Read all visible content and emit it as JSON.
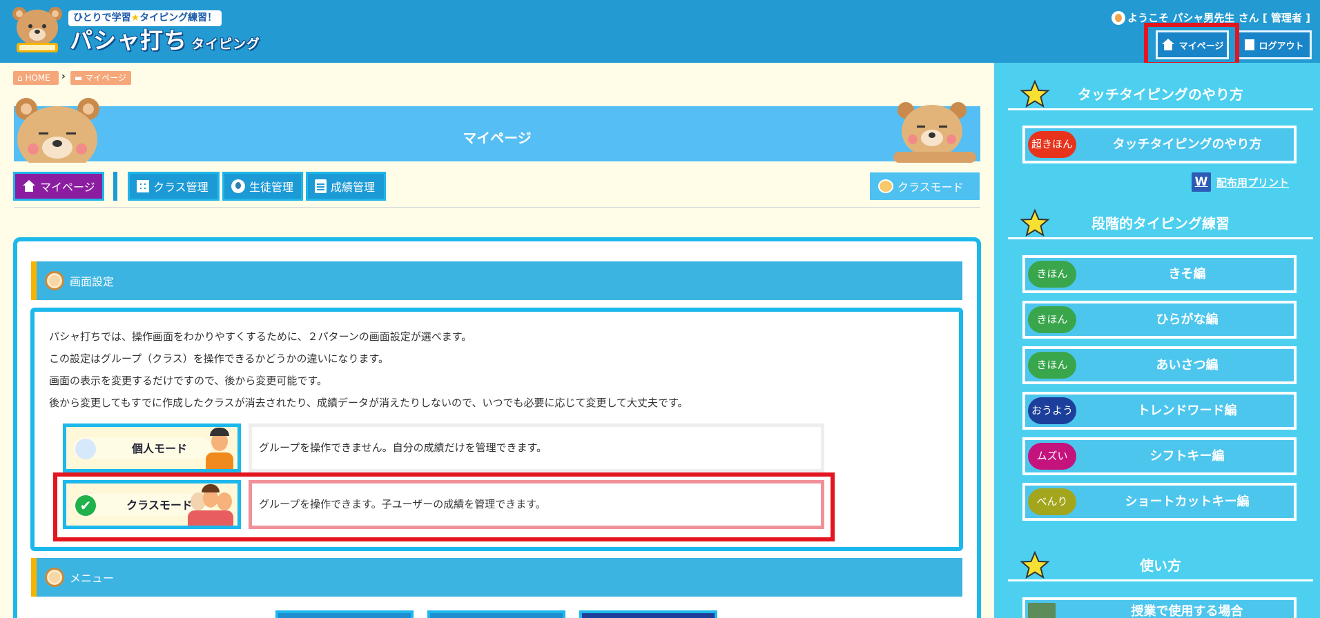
{
  "header": {
    "tagline_pre": "ひとりで学習",
    "tagline_post": "タイピング練習！",
    "logo_main": "パシャ打ち",
    "logo_sub": "タイピング",
    "welcome": "ようこそ パシャ男先生 さん [ 管理者 ]",
    "mypage_button": "マイページ",
    "logout_button": "ログアウト"
  },
  "breadcrumb": {
    "home": "HOME",
    "current": "マイページ"
  },
  "page_title": "マイページ",
  "nav": {
    "mypage": "マイページ",
    "class_manage": "クラス管理",
    "student_manage": "生徒管理",
    "grade_manage": "成績管理",
    "class_mode": "クラスモード"
  },
  "screen_settings": {
    "heading": "画面設定",
    "lines": [
      "パシャ打ちでは、操作画面をわかりやすくするために、２パターンの画面設定が選べます。",
      "この設定はグループ（クラス）を操作できるかどうかの違いになります。",
      "画面の表示を変更するだけですので、後から変更可能です。",
      "後から変更してもすでに作成したクラスが消去されたり、成績データが消えたりしないので、いつでも必要に応じて変更して大丈夫です。"
    ],
    "modes": [
      {
        "label": "個人モード",
        "desc": "グループを操作できません。自分の成績だけを管理できます。",
        "selected": false
      },
      {
        "label": "クラスモード",
        "desc": "グループを操作できます。子ユーザーの成績を管理できます。",
        "selected": true
      }
    ]
  },
  "menu_section": {
    "heading": "メニュー"
  },
  "sidebar": {
    "sections": [
      {
        "heading": "タッチタイピングのやり方",
        "items": [
          {
            "level": "超きほん",
            "label": "タッチタイピングのやり方",
            "color": "#e8331c"
          }
        ],
        "link": "配布用プリント",
        "link_icon": "W"
      },
      {
        "heading": "段階的タイピング練習",
        "items": [
          {
            "level": "きほん",
            "label": "きそ編",
            "color": "#3aa64c"
          },
          {
            "level": "きほん",
            "label": "ひらがな編",
            "color": "#3aa64c"
          },
          {
            "level": "きほん",
            "label": "あいさつ編",
            "color": "#3aa64c"
          },
          {
            "level": "おうよう",
            "label": "トレンドワード編",
            "color": "#1d3f9c"
          },
          {
            "level": "ムズい",
            "label": "シフトキー編",
            "color": "#c4137d"
          },
          {
            "level": "べんり",
            "label": "ショートカットキー編",
            "color": "#a3a61c"
          }
        ]
      },
      {
        "heading": "使い方",
        "items": [
          {
            "level": "",
            "label": "授業で使用する場合",
            "color": "#5b8c5a"
          }
        ]
      }
    ]
  },
  "colors": {
    "header": "#239ad2",
    "accent": "#1cb8ec",
    "highlight": "#e3151f",
    "sidebar": "#4dd0ef"
  }
}
